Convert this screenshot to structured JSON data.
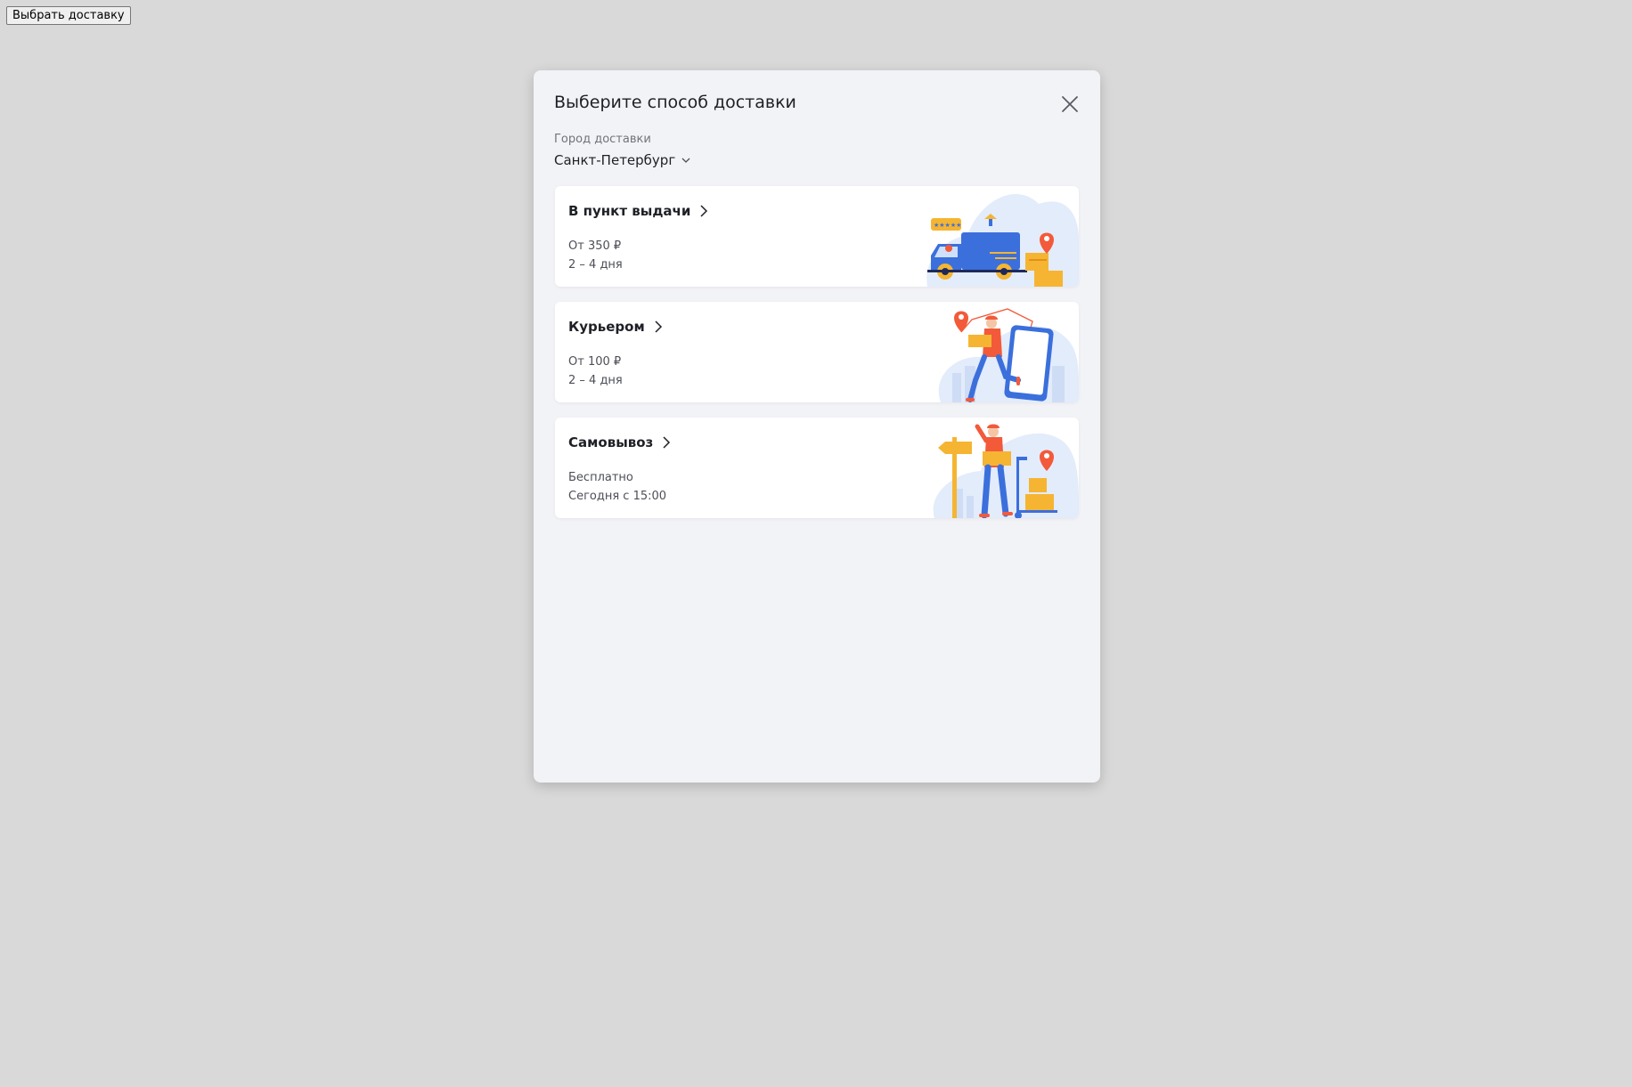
{
  "page": {
    "open_button_label": "Выбрать доставку"
  },
  "modal": {
    "title": "Выберите способ доставки",
    "city": {
      "label": "Город доставки",
      "value": "Санкт-Петербург"
    },
    "options": [
      {
        "title": "В пункт выдачи",
        "price": "От 350 ₽",
        "time": "2 – 4 дня",
        "illustration": "delivery-truck-illustration"
      },
      {
        "title": "Курьером",
        "price": "От 100 ₽",
        "time": "2 – 4 дня",
        "illustration": "courier-phone-illustration"
      },
      {
        "title": "Самовывоз",
        "price": "Бесплатно",
        "time": "Сегодня с 15:00",
        "illustration": "pickup-signpost-illustration"
      }
    ]
  },
  "colors": {
    "page_bg": "#d9d9d9",
    "modal_bg": "#f2f3f7",
    "card_bg": "#ffffff",
    "text_primary": "#1f2026",
    "text_secondary": "#70737a",
    "accent_blue": "#3b6fdc",
    "accent_orange": "#f59a23",
    "accent_red": "#f25a3a"
  }
}
